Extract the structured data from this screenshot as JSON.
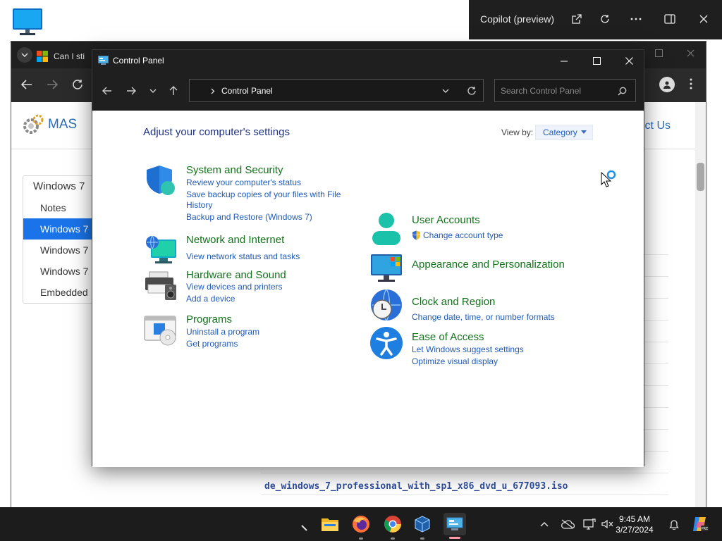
{
  "copilot": {
    "title": "Copilot (preview)"
  },
  "browser": {
    "tab_title": "Can I sti",
    "site_logo": "MAS",
    "contact_partial": "ct Us",
    "sidebar": {
      "heading": "Windows 7",
      "items": [
        "Notes",
        "Windows 7",
        "Windows 7",
        "Windows 7",
        "Embedded"
      ],
      "active_index": 1
    },
    "iso_rows": [
      "de_windows_7_professional_with_sp1_x86_dvd_u_677093.iso"
    ]
  },
  "control_panel": {
    "window_title": "Control Panel",
    "address": "Control Panel",
    "search_placeholder": "Search Control Panel",
    "heading": "Adjust your computer's settings",
    "view_by_label": "View by:",
    "view_by_value": "Category",
    "categories_left": [
      {
        "title": "System and Security",
        "links": [
          "Review your computer's status",
          "Save backup copies of your files with File History",
          "Backup and Restore (Windows 7)"
        ]
      },
      {
        "title": "Network and Internet",
        "links": [
          "View network status and tasks"
        ]
      },
      {
        "title": "Hardware and Sound",
        "links": [
          "View devices and printers",
          "Add a device"
        ]
      },
      {
        "title": "Programs",
        "links": [
          "Uninstall a program",
          "Get programs"
        ]
      }
    ],
    "categories_right": [
      {
        "title": "User Accounts",
        "links": [
          "Change account type"
        ]
      },
      {
        "title": "Appearance and Personalization",
        "links": []
      },
      {
        "title": "Clock and Region",
        "links": [
          "Change date, time, or number formats"
        ]
      },
      {
        "title": "Ease of Access",
        "links": [
          "Let Windows suggest settings",
          "Optimize visual display"
        ]
      }
    ]
  },
  "taskbar": {
    "time": "9:45 AM",
    "date": "3/27/2024",
    "apps": [
      "file-explorer",
      "firefox",
      "chrome",
      "virtualbox",
      "control-panel"
    ]
  },
  "colors": {
    "accent": "#1a73e8",
    "category_title": "#12731a",
    "link": "#1f5bb8",
    "heading": "#1e3287",
    "titlebar": "#1f1f1f"
  }
}
